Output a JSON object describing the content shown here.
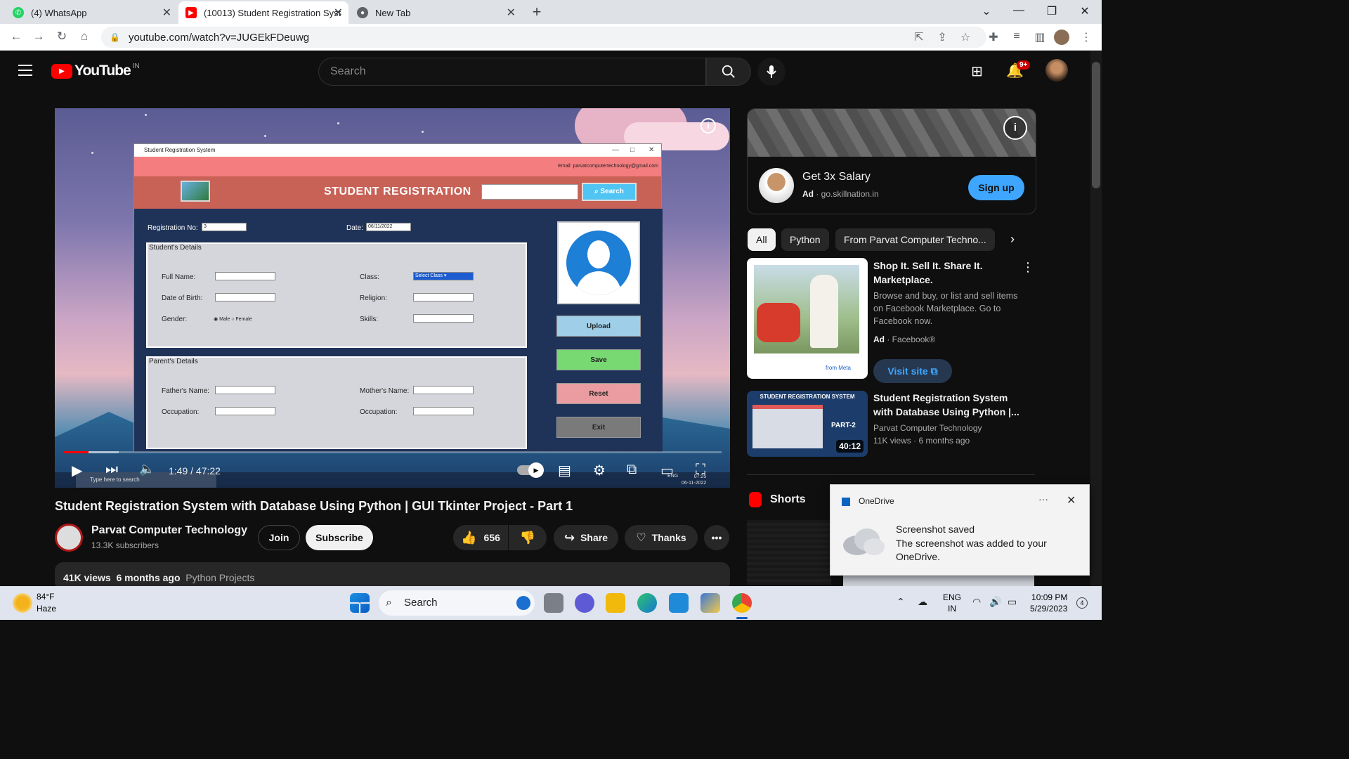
{
  "browser": {
    "tabs": [
      {
        "title": "(4) WhatsApp"
      },
      {
        "title": "(10013) Student Registration Syst"
      },
      {
        "title": "New Tab"
      }
    ],
    "url": "youtube.com/watch?v=JUGEkFDeuwg"
  },
  "youtube": {
    "logo_text": "YouTube",
    "country": "IN",
    "search_placeholder": "Search",
    "notif_badge": "9+"
  },
  "player": {
    "time": "1:49 / 47:22",
    "progress_fraction": 0.038,
    "buffer_fraction": 0.084
  },
  "tk_app": {
    "window_title": "Student Registration System",
    "email": "Email: parvatcomputertechnology@gmail.com",
    "title": "STUDENT REGISTRATION",
    "search_btn": "Search",
    "reg_no_label": "Registration No:",
    "reg_no_value": "3",
    "date_label": "Date:",
    "date_value": "06/11/2022",
    "students_details": "Student's Details",
    "full_name": "Full Name:",
    "dob": "Date of Birth:",
    "gender": "Gender:",
    "male": "Male",
    "female": "Female",
    "class": "Class:",
    "class_select": "Select Class",
    "religion": "Religion:",
    "skills": "Skills:",
    "parents_details": "Parent's Details",
    "father_name": "Father's Name:",
    "mother_name": "Mother's Name:",
    "occupation": "Occupation:",
    "upload": "Upload",
    "save": "Save",
    "reset": "Reset",
    "exit": "Exit",
    "taskbar_search": "Type here to search",
    "taskbar_lang": "ENG",
    "taskbar_time": "07:25",
    "taskbar_date": "06-11-2022"
  },
  "video": {
    "title": "Student Registration System with Database Using Python | GUI Tkinter Project - Part 1",
    "channel": "Parvat Computer Technology",
    "subscribers": "13.3K subscribers",
    "join": "Join",
    "subscribe": "Subscribe",
    "likes": "656",
    "share": "Share",
    "thanks": "Thanks",
    "views": "41K views",
    "age": "6 months ago",
    "tag": "Python Projects"
  },
  "ad": {
    "title": "Get 3x Salary",
    "badge": "Ad",
    "domain": "go.skillnation.in",
    "cta": "Sign up"
  },
  "chips": [
    "All",
    "Python",
    "From Parvat Computer Techno..."
  ],
  "recommendations": [
    {
      "title": "Shop It. Sell It. Share It. Marketplace.",
      "desc": "Browse and buy, or list and sell items on Facebook Marketplace. Go to Facebook now.",
      "badge": "Ad",
      "advertiser": "Facebook®",
      "cta": "Visit site",
      "thumb_brand": "from Meta"
    },
    {
      "title": "Student Registration System with Database Using Python |...",
      "channel": "Parvat Computer Technology",
      "views": "11K views",
      "age": "6 months ago",
      "duration": "40:12",
      "thumb_title": "STUDENT REGISTRATION SYSTEM",
      "thumb_part": "PART-2"
    }
  ],
  "shorts_label": "Shorts",
  "toast": {
    "app": "OneDrive",
    "heading": "Screenshot saved",
    "body": "The screenshot was added to your OneDrive."
  },
  "taskbar": {
    "temp": "84°F",
    "weather": "Haze",
    "search": "Search",
    "lang1": "ENG",
    "lang2": "IN",
    "time": "10:09 PM",
    "date": "5/29/2023",
    "notif_count": "4"
  }
}
